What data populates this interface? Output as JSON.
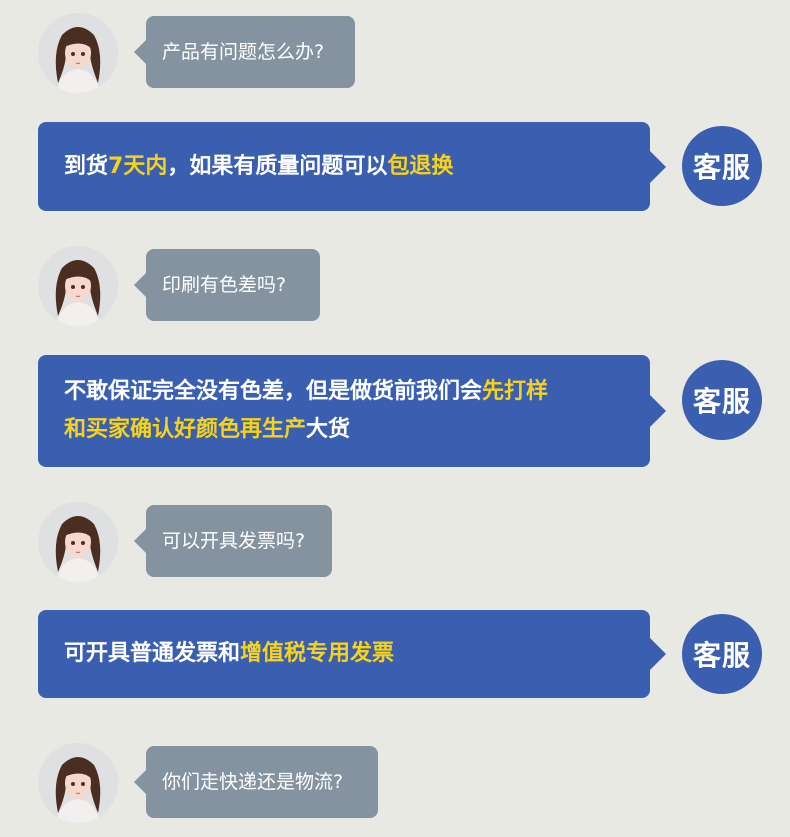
{
  "conversation": [
    {
      "question": "产品有问题怎么办?",
      "answer_lines": [
        [
          {
            "t": "到货"
          },
          {
            "t": "7天内",
            "hl": true
          },
          {
            "t": "，如果有质量问题可以"
          },
          {
            "t": "包退换",
            "hl": true
          }
        ]
      ]
    },
    {
      "question": "印刷有色差吗?",
      "answer_lines": [
        [
          {
            "t": "不敢保证完全没有色差，但是做货前我们会"
          },
          {
            "t": "先打样",
            "hl": true
          }
        ],
        [
          {
            "t": "和买家确认好颜色再生产",
            "hl": true
          },
          {
            "t": "大货"
          }
        ]
      ]
    },
    {
      "question": "可以开具发票吗?",
      "answer_lines": [
        [
          {
            "t": "可开具普通发票和"
          },
          {
            "t": "增值税专用发票",
            "hl": true
          }
        ]
      ]
    },
    {
      "question": "你们走快递还是物流?"
    }
  ],
  "agent_label": "客服",
  "colors": {
    "background": "#e9e9e4",
    "question_bubble": "#8593a1",
    "answer_bubble": "#3b5fb0",
    "highlight": "#f7d21b"
  }
}
